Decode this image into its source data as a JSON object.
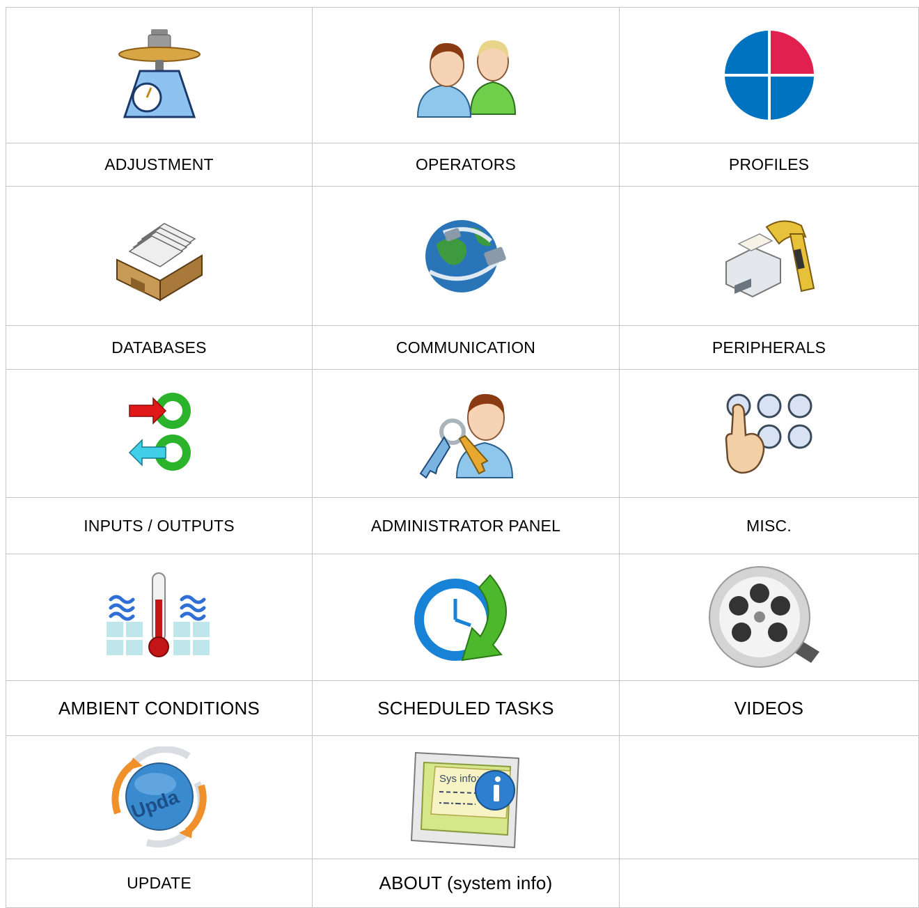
{
  "menu": {
    "items": [
      {
        "label": "ADJUSTMENT",
        "icon": "scale-icon"
      },
      {
        "label": "OPERATORS",
        "icon": "operators-icon"
      },
      {
        "label": "PROFILES",
        "icon": "profiles-icon"
      },
      {
        "label": "DATABASES",
        "icon": "file-drawer-icon"
      },
      {
        "label": "COMMUNICATION",
        "icon": "globe-network-icon"
      },
      {
        "label": "PERIPHERALS",
        "icon": "printer-scanner-icon"
      },
      {
        "label": "INPUTS / OUTPUTS",
        "icon": "io-arrows-icon"
      },
      {
        "label": "ADMINISTRATOR PANEL",
        "icon": "admin-keys-icon"
      },
      {
        "label": "MISC.",
        "icon": "touch-buttons-icon"
      },
      {
        "label": "AMBIENT CONDITIONS",
        "icon": "thermometer-icon"
      },
      {
        "label": "SCHEDULED TASKS",
        "icon": "clock-arrow-icon"
      },
      {
        "label": "VIDEOS",
        "icon": "film-reel-icon"
      },
      {
        "label": "UPDATE",
        "icon": "update-globe-icon",
        "icon_text": "Upda"
      },
      {
        "label": "ABOUT (system info)",
        "icon": "sys-info-card-icon",
        "icon_text": "Sys info:"
      }
    ]
  },
  "colors": {
    "grid_line": "#c6c6c6",
    "profiles_blue": "#0073c0",
    "profiles_red": "#e0204f"
  }
}
